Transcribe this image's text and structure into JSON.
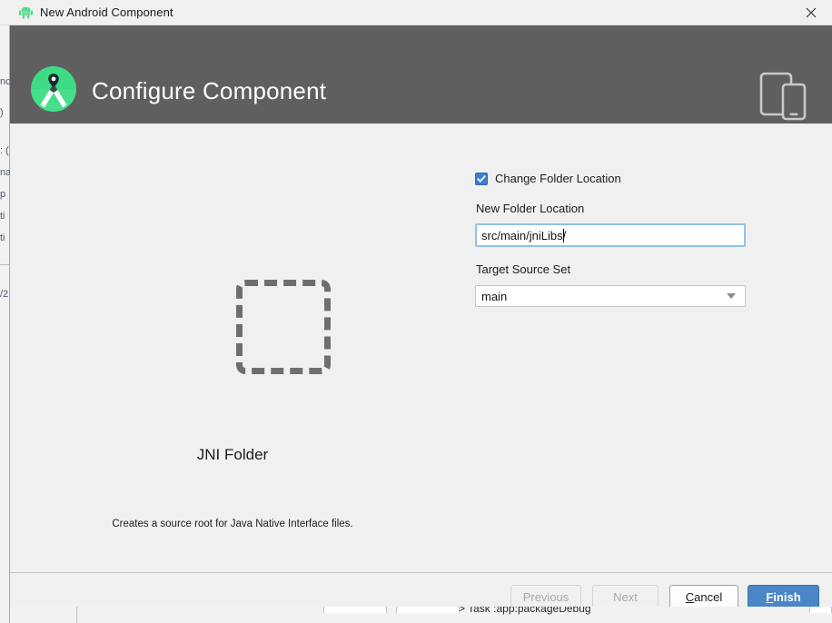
{
  "window": {
    "title": "New Android Component",
    "app_icon": "android-robot-icon",
    "close_label": "✕"
  },
  "dialog": {
    "header": {
      "title": "Configure Component",
      "logo_icon": "android-studio-logo-icon",
      "device_icon": "tablet-and-phone-icon",
      "background_color": "#5f5f5f"
    },
    "preview": {
      "shape_icon": "dashed-folder-outline-icon",
      "title": "JNI Folder",
      "description": "Creates a source root for Java Native Interface files."
    },
    "form": {
      "change_folder_location": {
        "label": "Change Folder Location",
        "checked": true,
        "check_icon": "checkmark-icon"
      },
      "new_folder_location": {
        "label": "New Folder Location",
        "value": "src/main/jniLibs",
        "value_tail": "/",
        "placeholder": "src/main/jniLibs/",
        "focused": true
      },
      "target_source_set": {
        "label": "Target Source Set",
        "value": "main",
        "options": [
          "main"
        ],
        "arrow_icon": "chevron-down-icon"
      }
    },
    "footer": {
      "previous": {
        "label": "Previous",
        "enabled": false
      },
      "next": {
        "label": "Next",
        "enabled": false
      },
      "cancel": {
        "label": "Cancel",
        "mnemonic": "C",
        "enabled": true
      },
      "finish": {
        "label": "Finish",
        "mnemonic": "F",
        "enabled": true,
        "default": true
      }
    }
  },
  "background_ide": {
    "left_fragments": [
      "nc",
      ")",
      ": (",
      "na",
      "p",
      "ti",
      "ti",
      "/2"
    ],
    "gradle_log_line": "> Task :app:packageDebug"
  },
  "colors": {
    "header_gray": "#5f5f5f",
    "body_gray": "#f0f0f0",
    "accent_blue": "#4a86c8",
    "checkbox_blue": "#3d7fd0",
    "focus_border": "#93c0e8"
  }
}
